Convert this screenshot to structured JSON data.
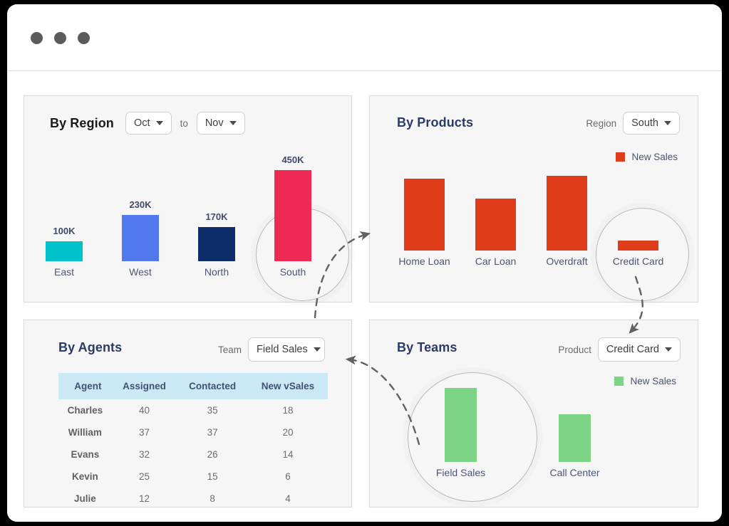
{
  "window": {
    "dots": [
      "window-dot-1",
      "window-dot-2",
      "window-dot-3"
    ]
  },
  "panels": {
    "region": {
      "title": "By Region",
      "from_month": "Oct",
      "to_word": "to",
      "to_month": "Nov"
    },
    "products": {
      "title": "By Products",
      "filter_label": "Region",
      "filter_value": "South",
      "legend_label": "New Sales",
      "legend_color": "#e03e1a"
    },
    "agents": {
      "title": "By Agents",
      "filter_label": "Team",
      "filter_value": "Field Sales"
    },
    "teams": {
      "title": "By Teams",
      "filter_label": "Product",
      "filter_value": "Credit Card",
      "legend_label": "New Sales",
      "legend_color": "#7ed485"
    }
  },
  "chart_data": [
    {
      "type": "bar",
      "title": "By Region",
      "xlabel": "",
      "ylabel": "",
      "categories": [
        "East",
        "West",
        "North",
        "South"
      ],
      "values": [
        100,
        230,
        170,
        450
      ],
      "value_labels": [
        "100K",
        "230K",
        "170K",
        "450K"
      ],
      "colors": [
        "#00c2cb",
        "#5179ed",
        "#0f2d6b",
        "#ee2a55"
      ],
      "ylim": [
        0,
        450
      ],
      "grid": false,
      "legend": "none",
      "highlighted": "South"
    },
    {
      "type": "bar",
      "title": "By Products",
      "xlabel": "",
      "ylabel": "",
      "categories": [
        "Home Loan",
        "Car Loan",
        "Overdraft",
        "Credit Card"
      ],
      "values": [
        100,
        72,
        104,
        14
      ],
      "colors": [
        "#e03e1a",
        "#e03e1a",
        "#e03e1a",
        "#e03e1a"
      ],
      "series": [
        {
          "name": "New Sales",
          "values": [
            100,
            72,
            104,
            14
          ]
        }
      ],
      "grid": false,
      "legend": "top-right",
      "highlighted": "Credit Card"
    },
    {
      "type": "table",
      "title": "By Agents",
      "columns": [
        "Agent",
        "Assigned",
        "Contacted",
        "New vSales"
      ],
      "rows": [
        [
          "Charles",
          "40",
          "35",
          "18"
        ],
        [
          "William",
          "37",
          "37",
          "20"
        ],
        [
          "Evans",
          "32",
          "26",
          "14"
        ],
        [
          "Kevin",
          "25",
          "15",
          "6"
        ],
        [
          "Julie",
          "12",
          "8",
          "4"
        ]
      ]
    },
    {
      "type": "bar",
      "title": "By Teams",
      "xlabel": "",
      "ylabel": "",
      "categories": [
        "Field Sales",
        "Call Center"
      ],
      "values": [
        96,
        62
      ],
      "colors": [
        "#7ed485",
        "#7ed485"
      ],
      "series": [
        {
          "name": "New Sales",
          "values": [
            96,
            62
          ]
        }
      ],
      "grid": false,
      "legend": "top-right",
      "highlighted": "Field Sales"
    }
  ],
  "connectors": [
    {
      "name": "region-to-products",
      "direction": "right"
    },
    {
      "name": "products-to-teams",
      "direction": "down-left"
    },
    {
      "name": "teams-to-agents",
      "direction": "left"
    }
  ]
}
